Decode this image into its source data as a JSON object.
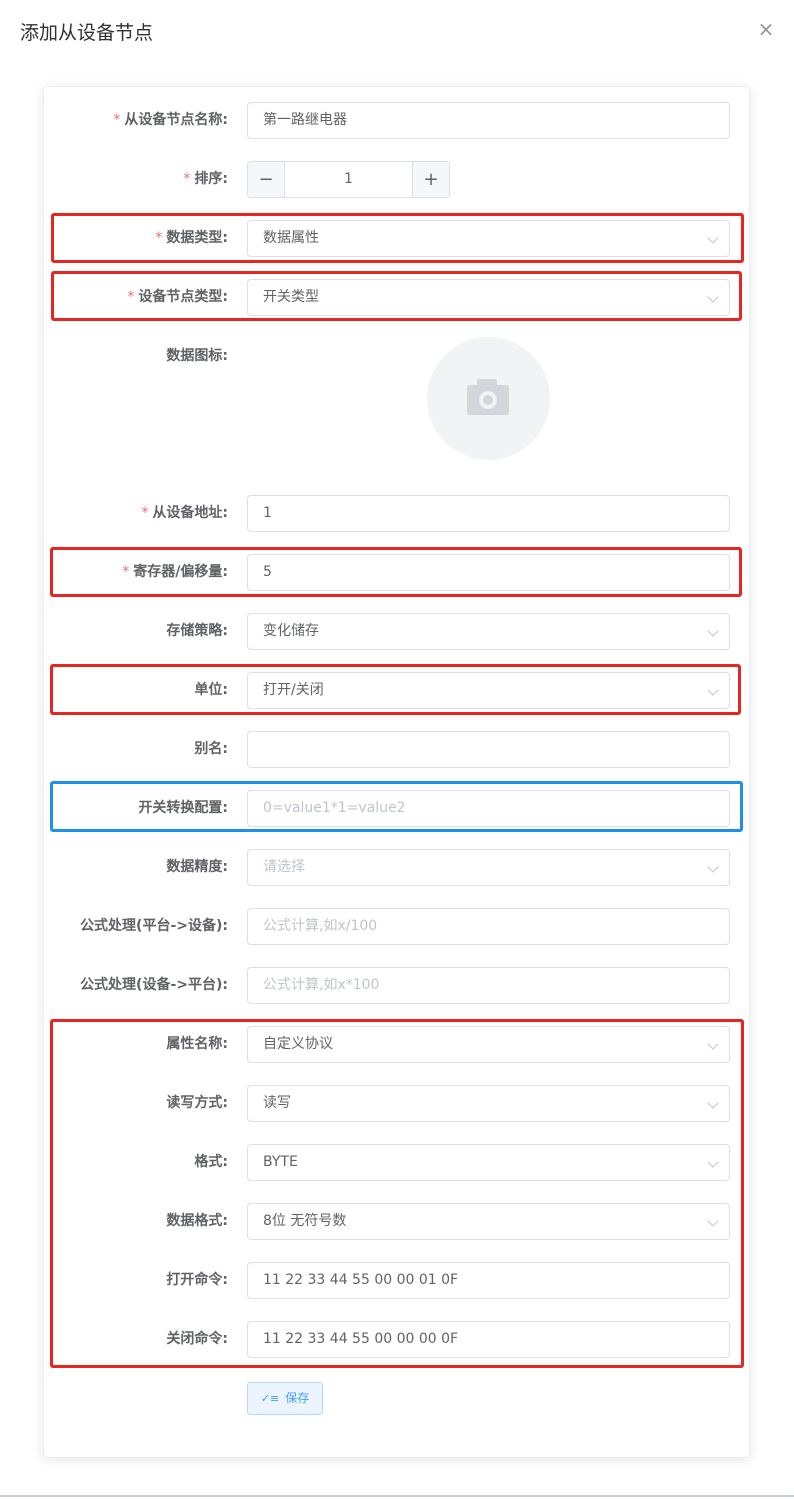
{
  "dialog": {
    "title": "添加从设备节点",
    "close_glyph": "×"
  },
  "form": {
    "node_name": {
      "label": "从设备节点名称:",
      "required": "*",
      "value": "第一路继电器"
    },
    "sort": {
      "label": "排序:",
      "required": "*",
      "value": "1",
      "minus": "−",
      "plus": "+"
    },
    "data_type": {
      "label": "数据类型:",
      "required": "*",
      "value": "数据属性"
    },
    "node_type": {
      "label": "设备节点类型:",
      "required": "*",
      "value": "开关类型"
    },
    "data_icon": {
      "label": "数据图标:",
      "icon": "camera-icon"
    },
    "slave_address": {
      "label": "从设备地址:",
      "required": "*",
      "value": "1"
    },
    "register_offset": {
      "label": "寄存器/偏移量:",
      "required": "*",
      "value": "5"
    },
    "storage_policy": {
      "label": "存储策略:",
      "value": "变化储存"
    },
    "unit": {
      "label": "单位:",
      "value": "打开/关闭"
    },
    "alias": {
      "label": "别名:",
      "value": ""
    },
    "switch_config": {
      "label": "开关转换配置:",
      "placeholder": "0=value1*1=value2"
    },
    "precision": {
      "label": "数据精度:",
      "placeholder": "请选择"
    },
    "formula_to_device": {
      "label": "公式处理(平台->设备):",
      "placeholder": "公式计算,如x/100"
    },
    "formula_to_platform": {
      "label": "公式处理(设备->平台):",
      "placeholder": "公式计算,如x*100"
    },
    "attr_name": {
      "label": "属性名称:",
      "value": "自定义协议"
    },
    "rw_mode": {
      "label": "读写方式:",
      "value": "读写"
    },
    "format": {
      "label": "格式:",
      "value": "BYTE"
    },
    "data_format": {
      "label": "数据格式:",
      "value": "8位 无符号数"
    },
    "open_cmd": {
      "label": "打开命令:",
      "value": "11 22 33 44 55 00 00 01 0F"
    },
    "close_cmd": {
      "label": "关闭命令:",
      "value": "11 22 33 44 55 00 00 00 0F"
    }
  },
  "actions": {
    "save_label": "保存",
    "save_icon": "✓≡"
  },
  "colors": {
    "highlight_red": "#e8251f",
    "highlight_blue": "#1f8fee",
    "required": "#f56c6c",
    "primary": "#409eff"
  }
}
